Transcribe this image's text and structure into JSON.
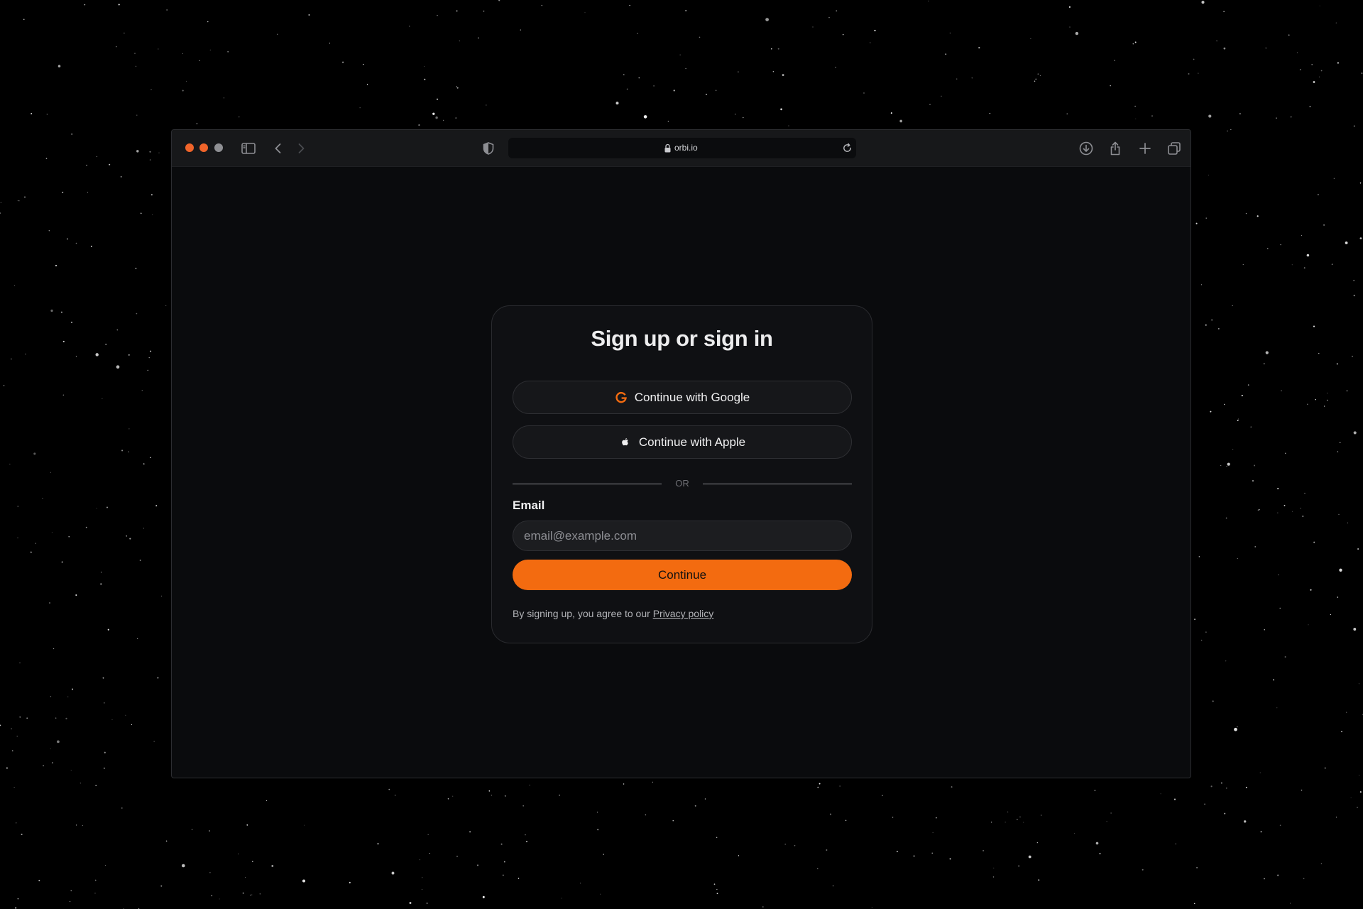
{
  "browser": {
    "url": "orbi.io",
    "traffic_lights": [
      "#f0642a",
      "#f0642a",
      "#8f9094"
    ],
    "icons": [
      "sidebar-icon",
      "back-icon",
      "forward-icon",
      "shield-icon",
      "lock-icon",
      "reload-icon",
      "download-icon",
      "share-icon",
      "new-tab-icon",
      "tabs-overview-icon"
    ]
  },
  "auth": {
    "title": "Sign up or sign in",
    "google_label": "Continue with Google",
    "apple_label": "Continue with Apple",
    "divider_text": "OR",
    "email_label": "Email",
    "email_value": "",
    "email_placeholder": "email@example.com",
    "continue_label": "Continue",
    "terms_prefix": "By signing up, you agree to our ",
    "privacy_link": "Privacy policy"
  },
  "colors": {
    "accent": "#f36b10",
    "background": "#0a0b0d",
    "card": "#0f1013"
  }
}
